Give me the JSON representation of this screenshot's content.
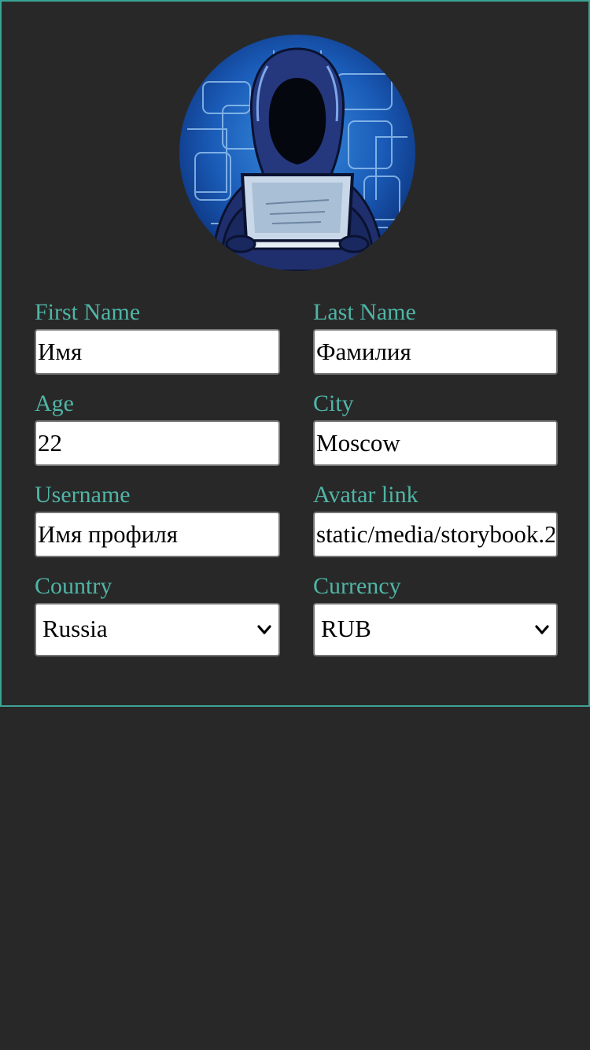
{
  "form": {
    "fields": {
      "first_name": {
        "label": "First Name",
        "value": "Имя"
      },
      "last_name": {
        "label": "Last Name",
        "value": "Фамилия"
      },
      "age": {
        "label": "Age",
        "value": "22"
      },
      "city": {
        "label": "City",
        "value": "Moscow"
      },
      "username": {
        "label": "Username",
        "value": "Имя профиля"
      },
      "avatar_link": {
        "label": "Avatar link",
        "value": "static/media/storybook.2"
      },
      "country": {
        "label": "Country",
        "value": "Russia"
      },
      "currency": {
        "label": "Currency",
        "value": "RUB"
      }
    }
  },
  "theme": {
    "background": "#282828",
    "border_accent": "#3aa394",
    "label_color": "#4fb5a6"
  },
  "icons": {
    "avatar": "hooded-hacker-avatar",
    "select_arrow": "chevron-down-icon"
  }
}
